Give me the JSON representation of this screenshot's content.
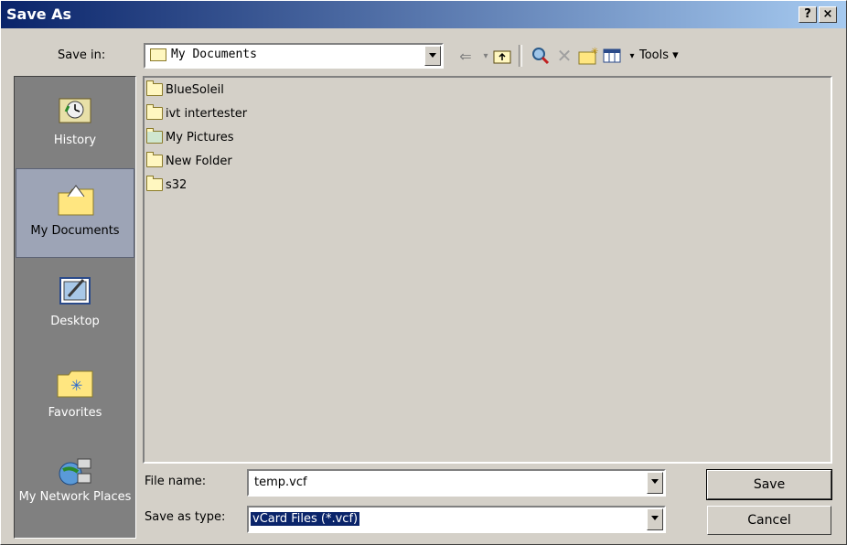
{
  "window": {
    "title": "Save As",
    "help_label": "?",
    "close_label": "×"
  },
  "toolbar": {
    "save_in_label": "Save in:",
    "location": "My Documents",
    "tools_label": "Tools ▾",
    "icons": [
      "back-icon",
      "up-folder-icon",
      "search-web-icon",
      "delete-icon",
      "new-folder-icon",
      "views-icon"
    ]
  },
  "places": [
    {
      "name": "History",
      "icon": "history-icon"
    },
    {
      "name": "My Documents",
      "icon": "my-documents-icon"
    },
    {
      "name": "Desktop",
      "icon": "desktop-icon"
    },
    {
      "name": "Favorites",
      "icon": "favorites-icon"
    },
    {
      "name": "My Network Places",
      "icon": "network-places-icon"
    }
  ],
  "files": [
    {
      "name": "BlueSoleil",
      "icon": "folder-icon"
    },
    {
      "name": "ivt intertester",
      "icon": "folder-icon"
    },
    {
      "name": "My Pictures",
      "icon": "pictures-folder-icon"
    },
    {
      "name": "New Folder",
      "icon": "folder-icon"
    },
    {
      "name": "s32",
      "icon": "folder-icon"
    }
  ],
  "form": {
    "file_name_label": "File name:",
    "file_name_value": "temp.vcf",
    "type_label": "Save as type:",
    "type_value": "vCard Files (*.vcf)"
  },
  "buttons": {
    "save": "Save",
    "cancel": "Cancel"
  }
}
